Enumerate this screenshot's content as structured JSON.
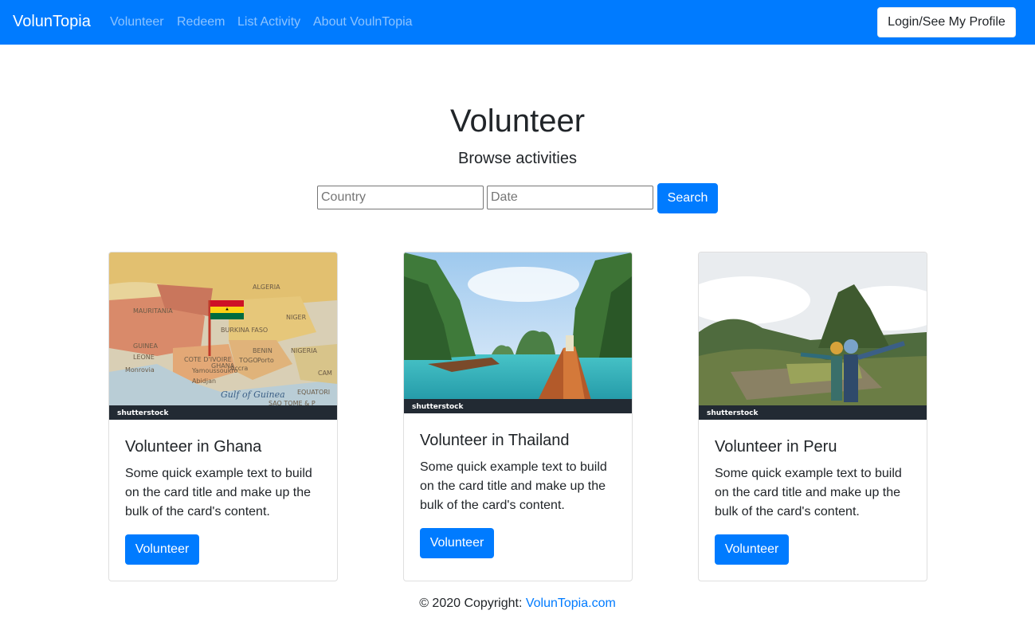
{
  "navbar": {
    "brand": "VolunTopia",
    "links": [
      "Volunteer",
      "Redeem",
      "List Activity",
      "About VoulnTopia"
    ],
    "login_label": "Login/See My Profile",
    "background": "#007bff"
  },
  "hero": {
    "title": "Volunteer",
    "subtitle": "Browse activities"
  },
  "search": {
    "country_placeholder": "Country",
    "date_placeholder": "Date",
    "button_label": "Search"
  },
  "cards": [
    {
      "title": "Volunteer in Ghana",
      "text": "Some quick example text to build on the card title and make up the bulk of the card's content.",
      "button_label": "Volunteer",
      "image_label": "shutterstock",
      "map_labels": [
        "ALGERIA",
        "MAURITANIA",
        "NIGER",
        "BURKINA FASO",
        "NIGERIA",
        "GUINEA",
        "BENIN",
        "TOGO",
        "GHANA",
        "COTE D'IVOIRE",
        "LEONE",
        "Monrovia",
        "Yamoussoukro",
        "Accra",
        "Abidjan",
        "Porto",
        "Gulf of Guinea",
        "EQUATORI",
        "CAM",
        "SAO TOME & P"
      ]
    },
    {
      "title": "Volunteer in Thailand",
      "text": "Some quick example text to build on the card title and make up the bulk of the card's content.",
      "button_label": "Volunteer",
      "image_label": "shutterstock"
    },
    {
      "title": "Volunteer in Peru",
      "text": "Some quick example text to build on the card title and make up the bulk of the card's content.",
      "button_label": "Volunteer",
      "image_label": "shutterstock"
    }
  ],
  "footer": {
    "copyright": "© 2020 Copyright: ",
    "link": "VolunTopia.com"
  }
}
